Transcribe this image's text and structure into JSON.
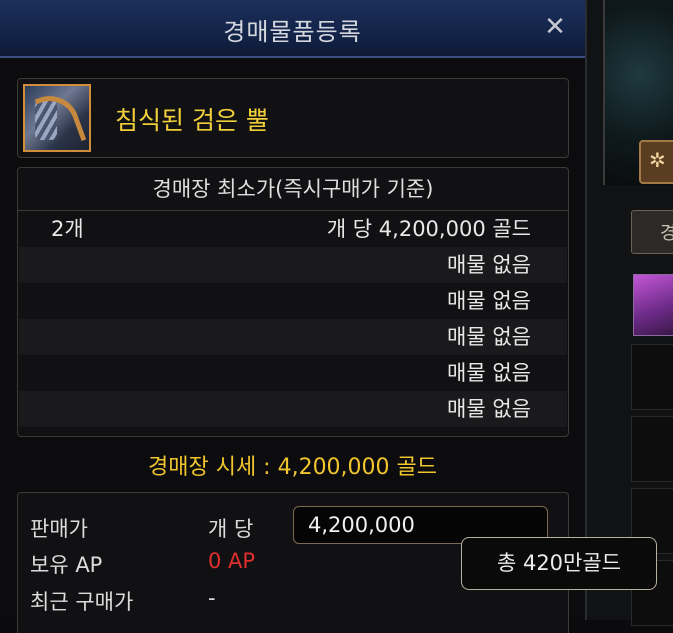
{
  "dialog": {
    "title": "경매물품등록",
    "close_symbol": "✕"
  },
  "item": {
    "name": "침식된 검은 뿔",
    "icon": "horn-item-icon"
  },
  "list": {
    "header": "경매장 최소가(즉시구매가 기준)",
    "rows": [
      {
        "qty": "2개",
        "price": "개 당 4,200,000 골드"
      },
      {
        "qty": "",
        "price": "매물 없음"
      },
      {
        "qty": "",
        "price": "매물 없음"
      },
      {
        "qty": "",
        "price": "매물 없음"
      },
      {
        "qty": "",
        "price": "매물 없음"
      },
      {
        "qty": "",
        "price": "매물 없음"
      }
    ]
  },
  "market_price": "경매장 시세 : 4,200,000 골드",
  "form": {
    "sale_price_label": "판매가",
    "per_unit_label": "개 당",
    "price_value": "4,200,000",
    "ap_label": "보유 AP",
    "ap_value": "0 AP",
    "recent_label": "최근 구매가",
    "recent_value": "-"
  },
  "tooltip": "총 420만골드",
  "colors": {
    "title_bar": "#132449",
    "gold_text": "#f0cf3a",
    "ap_red": "#e0302e"
  }
}
